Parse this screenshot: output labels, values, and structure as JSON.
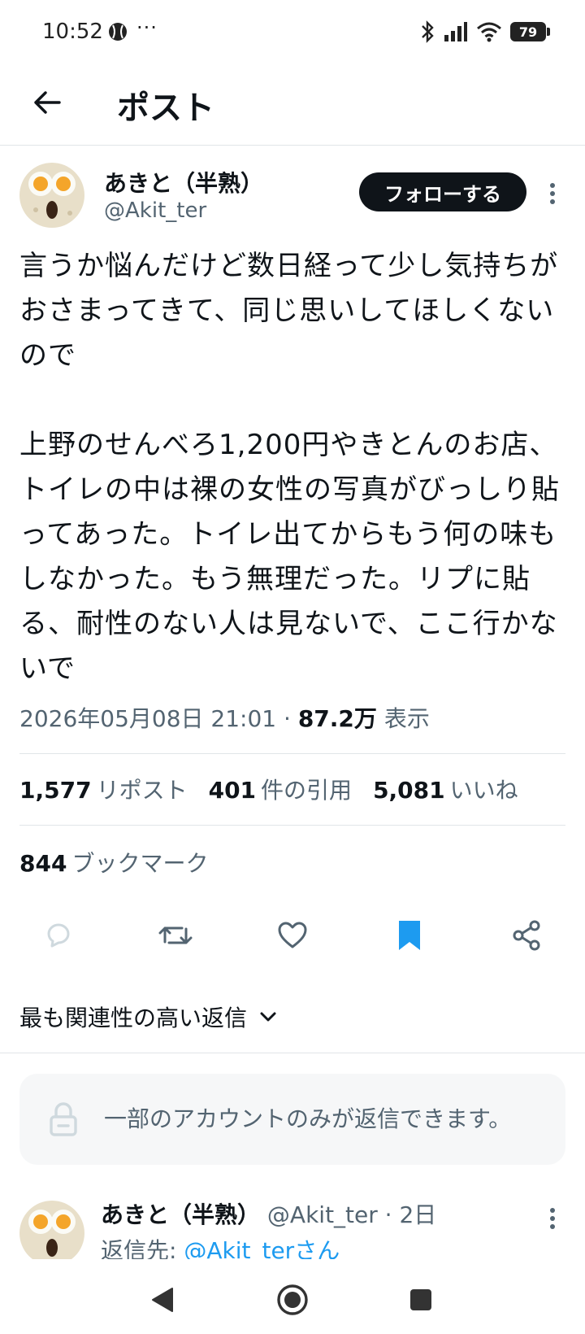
{
  "status_bar": {
    "time": "10:52",
    "dots": "···",
    "battery": "79"
  },
  "header": {
    "title": "ポスト"
  },
  "post": {
    "author_name": "あきと（半熟）",
    "author_handle": "@Akit_ter",
    "follow_label": "フォローする",
    "text": "言うか悩んだけど数日経って少し気持ちがおさまってきて、同じ思いしてほしくないので\n\n上野のせんべろ1,200円やきとんのお店、トイレの中は裸の女性の写真がびっしり貼ってあった。トイレ出てからもう何の味もしなかった。もう無理だった。リプに貼る、耐性のない人は見ないで、ここ行かないで",
    "timestamp": "2026年05月08日 21:01",
    "separator": "·",
    "views_count": "87.2万",
    "views_label": "表示",
    "reposts_count": "1,577",
    "reposts_label": "リポスト",
    "quotes_count": "401",
    "quotes_label": "件の引用",
    "likes_count": "5,081",
    "likes_label": "いいね",
    "bookmarks_count": "844",
    "bookmarks_label": "ブックマーク"
  },
  "sort": {
    "label": "最も関連性の高い返信"
  },
  "restricted_notice": "一部のアカウントのみが返信できます。",
  "reply": {
    "author_name": "あきと（半熟）",
    "author_handle": "@Akit_ter",
    "time": "· 2日",
    "reply_to_label": "返信先: ",
    "reply_to_user": "@Akit_terさん"
  },
  "colors": {
    "accent": "#1d9bf0",
    "text": "#0f1419",
    "secondary": "#536471"
  },
  "icons": [
    "back-arrow-icon",
    "reply-icon",
    "retweet-icon",
    "heart-icon",
    "bookmark-filled-icon",
    "share-icon",
    "lock-icon",
    "chevron-down-icon",
    "more-vertical-icon"
  ]
}
